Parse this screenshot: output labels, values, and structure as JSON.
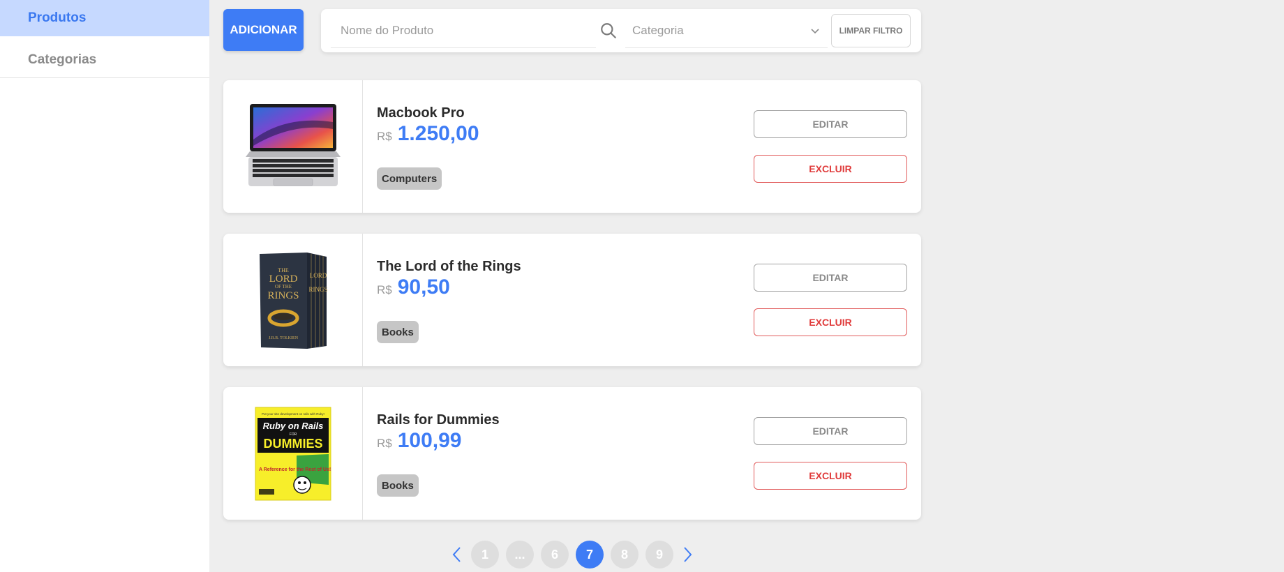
{
  "sidebar": {
    "items": [
      {
        "label": "Produtos",
        "active": true
      },
      {
        "label": "Categorias",
        "active": false
      }
    ]
  },
  "toolbar": {
    "add_label": "ADICIONAR",
    "search_placeholder": "Nome do Produto",
    "category_placeholder": "Categoria",
    "clear_label": "LIMPAR FILTRO"
  },
  "products": [
    {
      "name": "Macbook Pro",
      "currency": "R$",
      "price": "1.250,00",
      "category": "Computers",
      "image_icon": "laptop-image",
      "edit_label": "EDITAR",
      "delete_label": "EXCLUIR"
    },
    {
      "name": "The Lord of the Rings",
      "currency": "R$",
      "price": "90,50",
      "category": "Books",
      "image_icon": "book-box-set-image",
      "edit_label": "EDITAR",
      "delete_label": "EXCLUIR"
    },
    {
      "name": "Rails for Dummies",
      "currency": "R$",
      "price": "100,99",
      "category": "Books",
      "image_icon": "book-cover-image",
      "edit_label": "EDITAR",
      "delete_label": "EXCLUIR"
    }
  ],
  "pagination": {
    "pages": [
      "1",
      "...",
      "6",
      "7",
      "8",
      "9"
    ],
    "current": "7"
  },
  "book1": {
    "line1": "THE",
    "line2": "LORD",
    "line3": "OF THE",
    "line4": "RINGS",
    "author": "J.R.R. TOLKIEN"
  },
  "book2": {
    "top": "Put your site development on rails with Ruby!",
    "line1": "Ruby on Rails",
    "line2": "FOR",
    "line3": "DUMMIES",
    "sub": "A Reference for the Rest of Us!"
  },
  "colors": {
    "accent": "#3e7cf5",
    "sidebar_active_bg": "#c6d9ff",
    "danger": "#e03c3c",
    "badge_bg": "#c6c6c6"
  }
}
